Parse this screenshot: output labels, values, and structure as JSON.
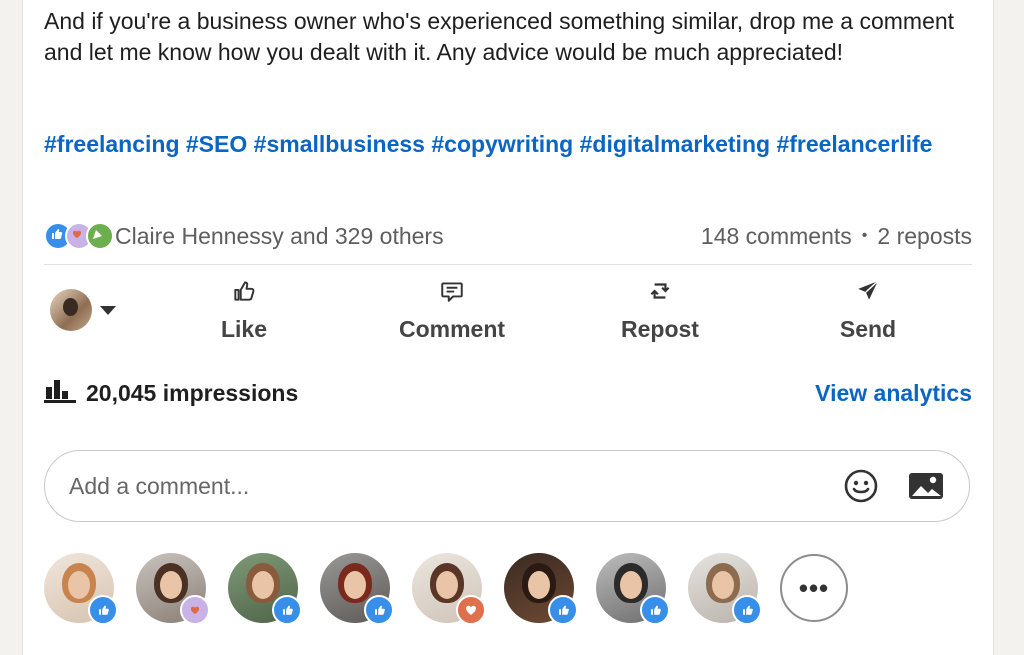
{
  "post": {
    "body_text": "And if you're a business owner who's experienced something similar, drop me a comment and let me know how you dealt with it. Any advice would be much appreciated!",
    "hashtags": [
      "#freelancing",
      "#SEO",
      "#smallbusiness",
      "#copywriting",
      "#digitalmarketing",
      "#freelancerlife"
    ]
  },
  "social": {
    "reactions_text": "Claire Hennessy and 329 others",
    "comments_text": "148 comments",
    "separator": "•",
    "reposts_text": "2 reposts",
    "reaction_icons": [
      "like-icon",
      "support-icon",
      "celebrate-icon"
    ]
  },
  "actions": {
    "like": "Like",
    "comment": "Comment",
    "repost": "Repost",
    "send": "Send"
  },
  "analytics": {
    "impressions_text": "20,045 impressions",
    "view_analytics_label": "View analytics"
  },
  "comment_box": {
    "placeholder": "Add a comment..."
  },
  "reactors": [
    {
      "reaction": "like"
    },
    {
      "reaction": "support"
    },
    {
      "reaction": "like"
    },
    {
      "reaction": "like"
    },
    {
      "reaction": "love"
    },
    {
      "reaction": "like"
    },
    {
      "reaction": "like"
    },
    {
      "reaction": "like"
    }
  ],
  "more_label": "•••",
  "colors": {
    "link_blue": "#0a66c2",
    "like_badge": "#378fe9",
    "love_badge": "#df704d",
    "support_badge": "#c9b3e6",
    "text_dark": "#1f1f1f",
    "text_muted": "#5e5e5e"
  }
}
